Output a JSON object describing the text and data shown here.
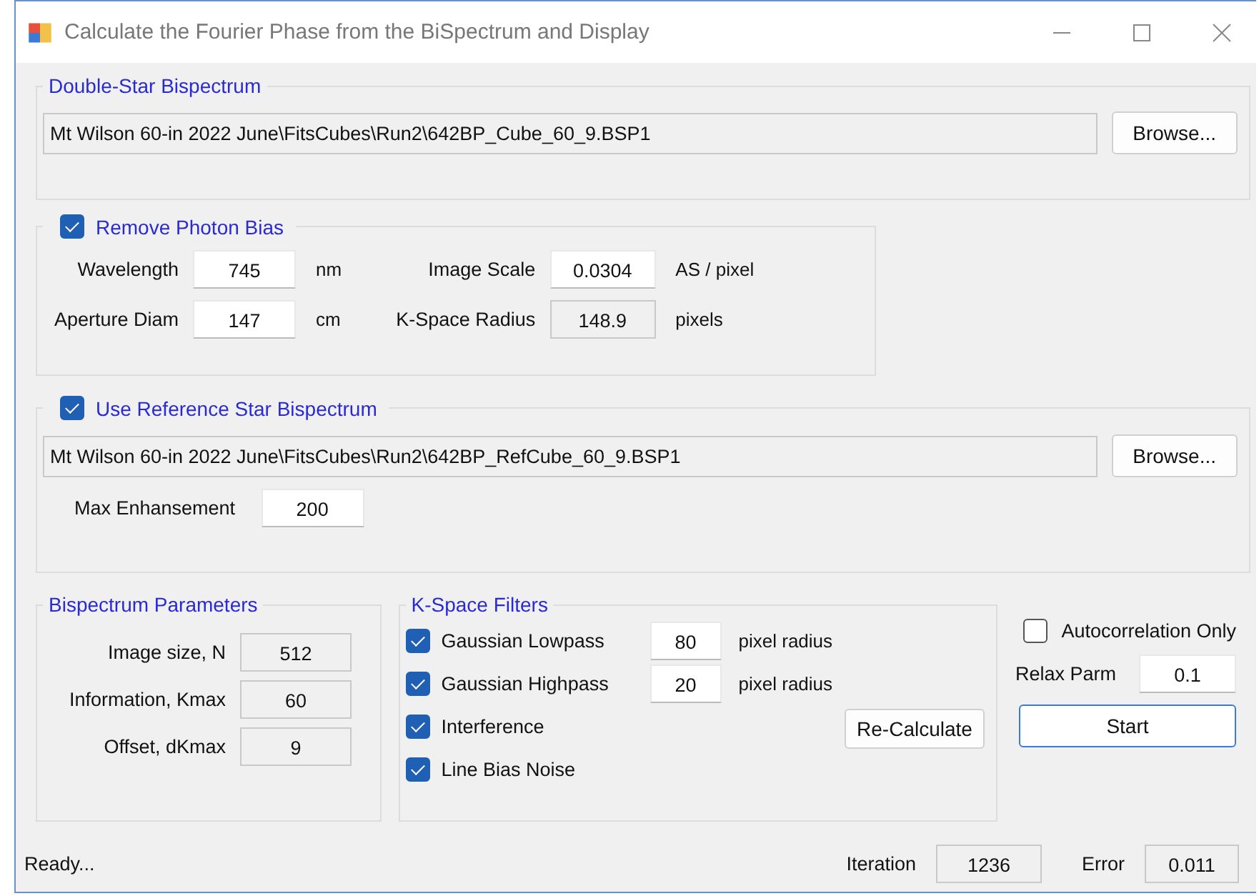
{
  "window": {
    "title": "Calculate the Fourier Phase from the BiSpectrum and Display"
  },
  "double_star": {
    "legend": "Double-Star Bispectrum",
    "path": "Mt Wilson 60-in 2022 June\\FitsCubes\\Run2\\642BP_Cube_60_9.BSP1",
    "browse": "Browse..."
  },
  "photon_bias": {
    "label": "Remove Photon Bias",
    "checked": true,
    "fields": [
      {
        "label": "Wavelength",
        "value": "745",
        "unit": "nm",
        "readonly": false
      },
      {
        "label": "Image Scale",
        "value": "0.0304",
        "unit": "AS / pixel",
        "readonly": false
      },
      {
        "label": "Aperture Diam",
        "value": "147",
        "unit": "cm",
        "readonly": false
      },
      {
        "label": "K-Space Radius",
        "value": "148.9",
        "unit": "pixels",
        "readonly": true
      }
    ]
  },
  "reference": {
    "label": "Use Reference Star Bispectrum",
    "checked": true,
    "path": "Mt Wilson 60-in 2022 June\\FitsCubes\\Run2\\642BP_RefCube_60_9.BSP1",
    "browse": "Browse...",
    "max_label": "Max Enhansement",
    "max_value": "200"
  },
  "bispectrum_parameters": {
    "legend": "Bispectrum Parameters",
    "fields": [
      {
        "label": "Image size, N",
        "value": "512"
      },
      {
        "label": "Information, Kmax",
        "value": "60"
      },
      {
        "label": "Offset, dKmax",
        "value": "9"
      }
    ]
  },
  "kspace_filters": {
    "legend": "K-Space Filters",
    "filters": [
      {
        "label": "Gaussian Lowpass",
        "checked": true,
        "value": "80",
        "unit": "pixel radius"
      },
      {
        "label": "Gaussian Highpass",
        "checked": true,
        "value": "20",
        "unit": "pixel radius"
      },
      {
        "label": "Interference",
        "checked": true
      },
      {
        "label": "Line Bias Noise",
        "checked": true
      }
    ],
    "recalculate": "Re-Calculate"
  },
  "autocorrelation": {
    "label": "Autocorrelation Only",
    "checked": false
  },
  "relax": {
    "label": "Relax Parm",
    "value": "0.1"
  },
  "start": "Start",
  "status_bar": {
    "status": "Ready...",
    "iteration_label": "Iteration",
    "iteration": "1236",
    "error_label": "Error",
    "error": "0.011"
  }
}
